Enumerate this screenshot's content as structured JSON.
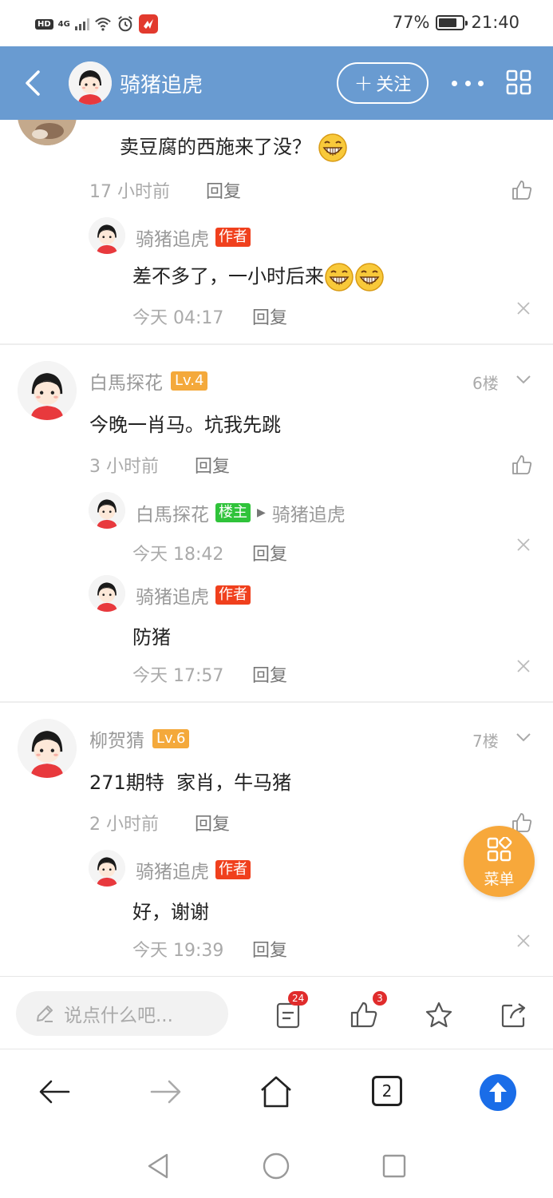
{
  "status_bar": {
    "hd": "HD",
    "network": "4G",
    "battery_percent": "77%",
    "battery_level": 0.77,
    "time": "21:40",
    "app_icon": "huawei-app-icon"
  },
  "header": {
    "title": "骑猪追虎",
    "follow_label": "关注",
    "accent_color": "#699bd1"
  },
  "comments": {
    "partial": {
      "text": "卖豆腐的西施来了没？",
      "time": "17 小时前",
      "reply_label": "回复",
      "sub_reply": {
        "user": "骑猪追虎",
        "badge": "作者",
        "text": "差不多了，一小时后来",
        "time": "今天 04:17",
        "reply_label": "回复"
      }
    },
    "floor6": {
      "user": "白馬探花",
      "level": "Lv.4",
      "floor": "6楼",
      "text": "今晚一肖马。坑我先跳",
      "time": "3 小时前",
      "reply_label": "回复",
      "sub_replies": [
        {
          "user": "白馬探花",
          "badge": "楼主",
          "target": "骑猪追虎",
          "time": "今天 18:42",
          "reply_label": "回复"
        },
        {
          "user": "骑猪追虎",
          "badge": "作者",
          "text": "防猪",
          "time": "今天 17:57",
          "reply_label": "回复"
        }
      ]
    },
    "floor7": {
      "user": "柳贺猜",
      "level": "Lv.6",
      "floor": "7楼",
      "text": "271期特  家肖，牛马猪",
      "time": "2 小时前",
      "reply_label": "回复",
      "sub_reply": {
        "user": "骑猪追虎",
        "badge": "作者",
        "text": "好，谢谢",
        "time": "今天 19:39",
        "reply_label": "回复"
      }
    }
  },
  "fab": {
    "label": "菜单"
  },
  "input_bar": {
    "placeholder": "说点什么吧...",
    "comment_count": "24",
    "like_count": "3"
  },
  "browser_bar": {
    "tabs_count": "2"
  }
}
